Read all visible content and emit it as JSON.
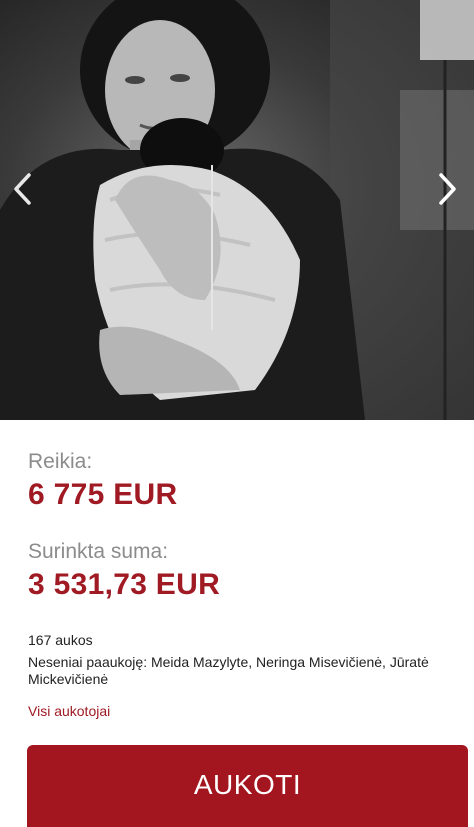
{
  "campaign": {
    "needed_label": "Reikia:",
    "needed_amount": "6 775 EUR",
    "collected_label": "Surinkta suma:",
    "collected_amount": "3 531,73 EUR",
    "donations_count": "167 aukos",
    "recent_donors": "Neseniai paaukoję: Meida Mazylyte, Neringa Misevičienė, Jūratė Mickevičienė",
    "all_donors_link": "Visi aukotojai"
  },
  "actions": {
    "donate_label": "AUKOTI"
  },
  "gallery": {
    "prev_icon": "chevron-left-icon",
    "next_icon": "chevron-right-icon"
  },
  "colors": {
    "accent": "#a3161f",
    "amount_text": "#9f1a23",
    "label_text": "#8c8c8c"
  }
}
